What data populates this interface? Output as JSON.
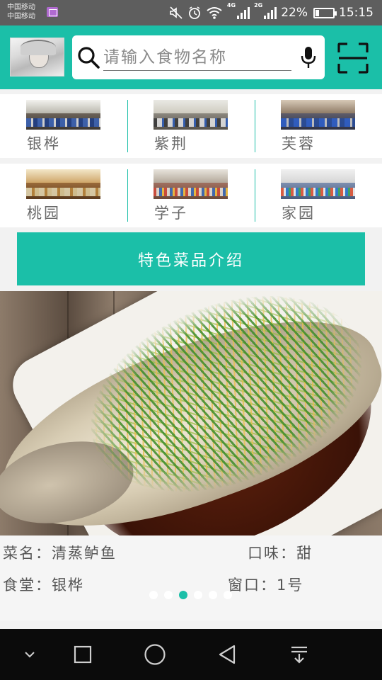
{
  "status_bar": {
    "carrier_1": "中国移动",
    "carrier_2": "中国移动",
    "network_4g": "4G",
    "network_2g": "2G",
    "battery_percent": "22%",
    "battery_level": 0.22,
    "time": "15:15"
  },
  "header": {
    "search": {
      "placeholder": "请输入食物名称",
      "value": ""
    }
  },
  "canteens": [
    {
      "label": "银桦"
    },
    {
      "label": "紫荆"
    },
    {
      "label": "芙蓉"
    },
    {
      "label": "桃园"
    },
    {
      "label": "学子"
    },
    {
      "label": "家园"
    }
  ],
  "feature_button": {
    "label": "特色菜品介绍"
  },
  "dish": {
    "name_label": "菜名：",
    "name": "清蒸鲈鱼",
    "taste_label": "口味：",
    "taste": "甜",
    "canteen_label": "食堂：",
    "canteen": "银桦",
    "window_label": "窗口：",
    "window": "1号"
  },
  "carousel": {
    "count": 6,
    "active_index": 2
  },
  "colors": {
    "accent": "#1bbfa8",
    "status_bar": "#5e5e5e",
    "nav_bar": "#0b0b0b"
  },
  "icons": [
    "scan-icon",
    "search-icon",
    "mic-icon",
    "back-icon",
    "home-icon",
    "recents-icon",
    "collapse-icon",
    "notification-icon"
  ]
}
